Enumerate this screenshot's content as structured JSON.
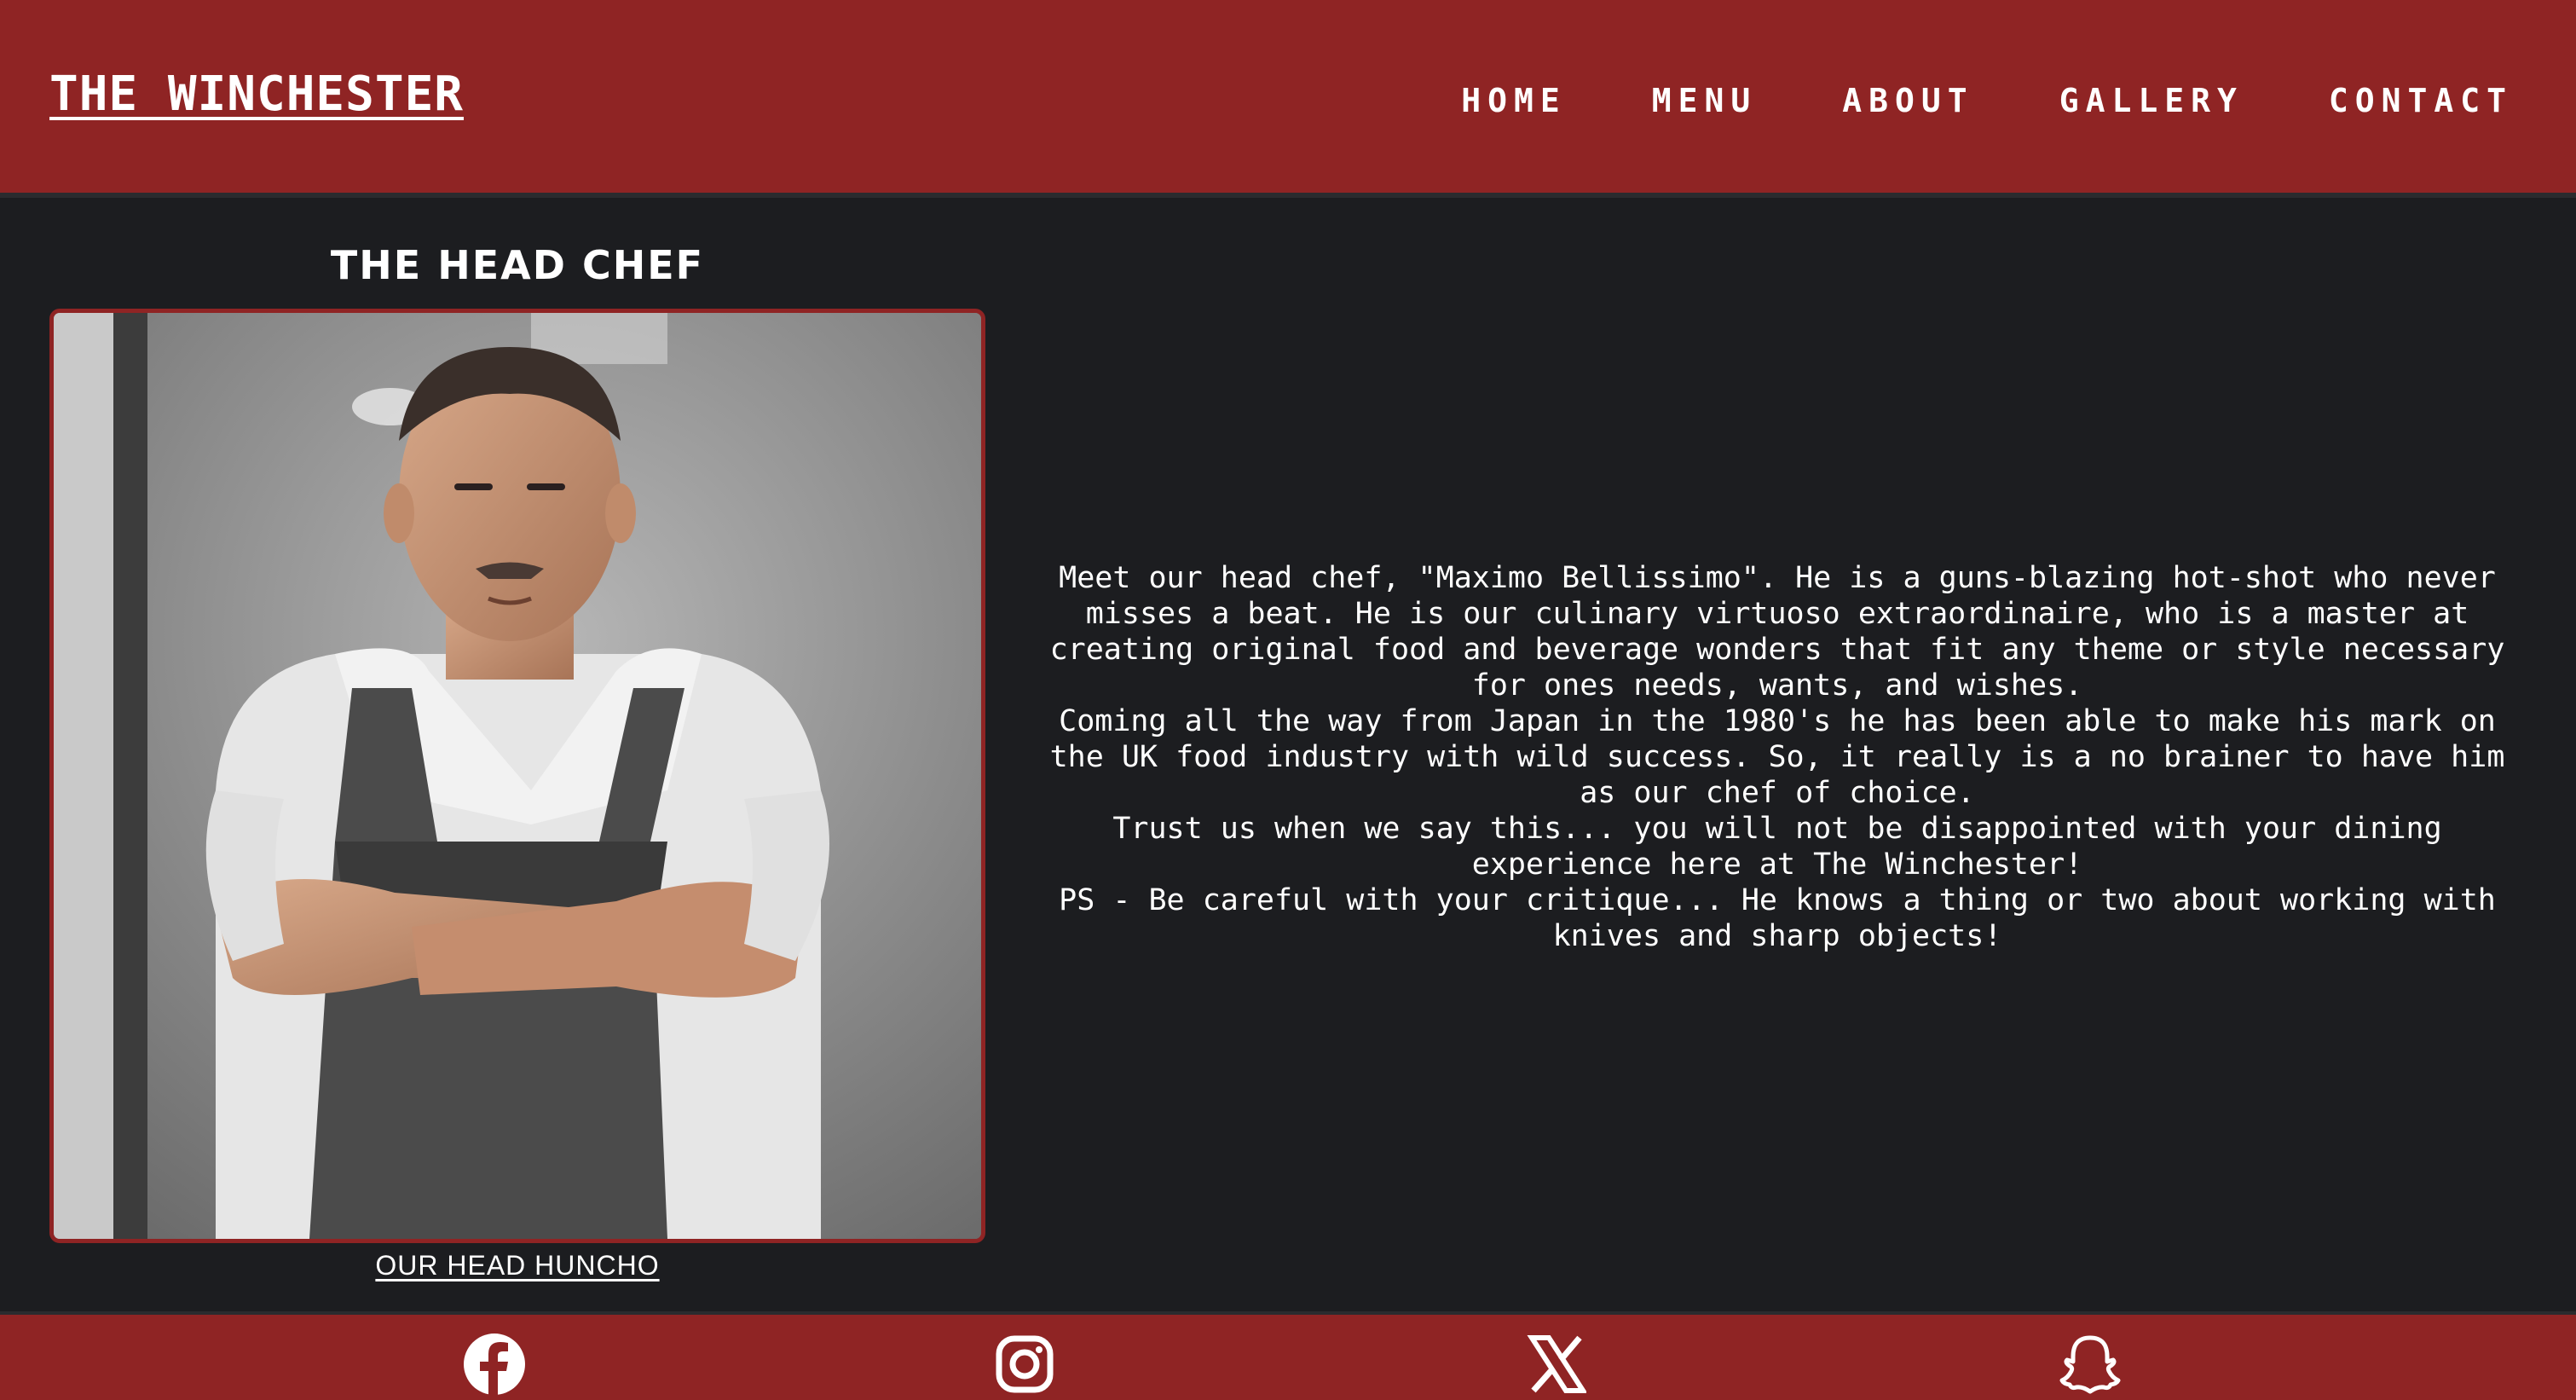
{
  "header": {
    "site_title": "THE WINCHESTER",
    "nav": [
      "HOME",
      "MENU",
      "ABOUT",
      "GALLERY",
      "CONTACT"
    ]
  },
  "chef": {
    "heading": "THE HEAD CHEF",
    "photo_caption": "OUR HEAD HUNCHO",
    "bio": [
      "Meet our head chef, \"Maximo Bellissimo\". He is a guns-blazing hot-shot who never misses a beat. He is our culinary virtuoso extraordinaire, who is a master at creating original food and beverage wonders that fit any theme or style necessary for ones needs, wants, and wishes.",
      "Coming all the way from Japan in the 1980's he has been able to make his mark on the UK food industry with wild success. So, it really is a no brainer to have him as our chef of choice.",
      "Trust us when we say this... you will not be disappointed with your dining experience here at The Winchester!",
      "PS - Be careful with your critique... He knows a thing or two about working with knives and sharp objects!"
    ]
  },
  "footer": {
    "social_icons": [
      "facebook-icon",
      "instagram-icon",
      "x-icon",
      "snapchat-icon"
    ]
  },
  "colors": {
    "brand_red": "#8f2424",
    "background": "#1c1d20",
    "text": "#ffffff"
  }
}
